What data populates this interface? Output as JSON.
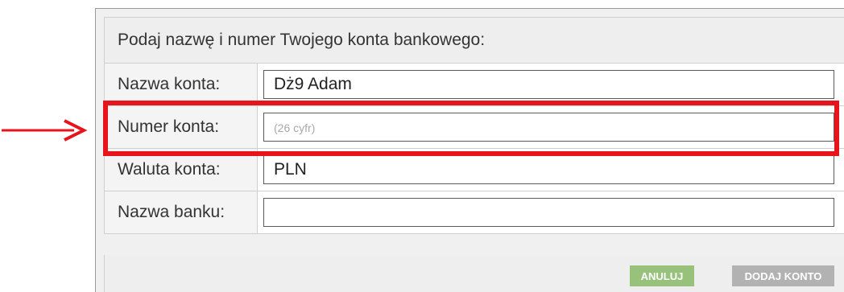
{
  "dialog": {
    "title": "Podaj nazwę i numer Twojego konta bankowego:"
  },
  "form": {
    "fields": [
      {
        "label": "Nazwa konta:",
        "value": "Dż9 Adam",
        "placeholder": ""
      },
      {
        "label": "Numer konta:",
        "value": "",
        "placeholder": "(26 cyfr)"
      },
      {
        "label": "Waluta konta:",
        "value": "PLN",
        "placeholder": ""
      },
      {
        "label": "Nazwa banku:",
        "value": "",
        "placeholder": ""
      }
    ]
  },
  "buttons": {
    "cancel": "ANULUJ",
    "add": "DODAJ KONTO"
  },
  "annotation": {
    "color": "#e8141c",
    "icon": "arrow-right-icon"
  }
}
